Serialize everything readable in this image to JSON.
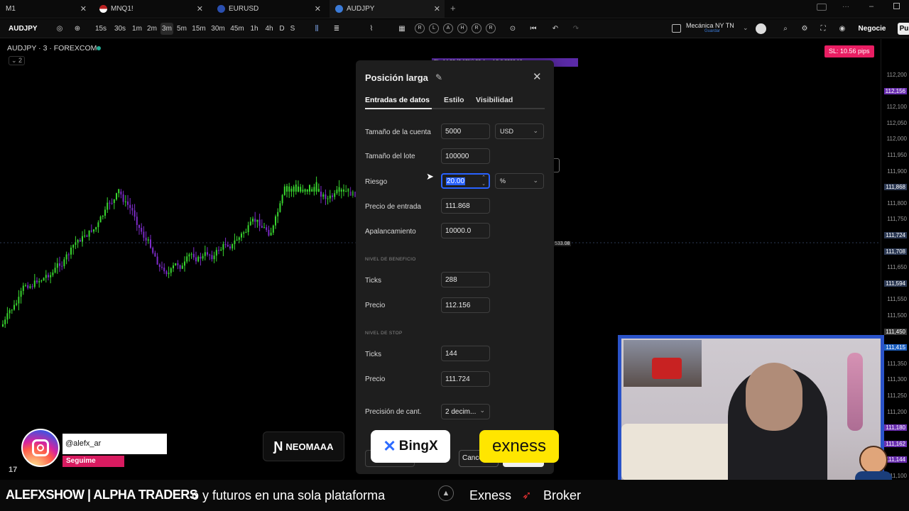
{
  "browser_tabs": [
    {
      "label": "M1",
      "icon": "chart-icon",
      "active": false
    },
    {
      "label": "MNQ1!",
      "icon": "us-flag-icon",
      "active": false
    },
    {
      "label": "EURUSD",
      "icon": "eu-flag-icon",
      "active": false
    },
    {
      "label": "AUDJPY",
      "icon": "tradingview-icon",
      "active": true
    }
  ],
  "toolbar": {
    "symbol": "AUDJPY",
    "intervals": [
      "15s",
      "30s",
      "1m",
      "2m",
      "3m",
      "5m",
      "15m",
      "30m",
      "45m",
      "1h",
      "4h",
      "D",
      "S"
    ],
    "active_interval": "3m",
    "replay": [
      "R",
      "L",
      "A",
      "H",
      "R",
      "R"
    ],
    "layout_name": "Mecánica NY TN",
    "layout_sub": "Guardar",
    "trade_button": "Negocie",
    "publish_button": "Pu"
  },
  "chart": {
    "title": "AUDJPY · 3 · FOREXCOM",
    "indicator_count": "2",
    "sl_badge": "SL: 10.56 pips",
    "target_label": "PL: 14.22 (0.12%) 20.4 ... 4 5 6 8266.16",
    "stop_label": "533.08",
    "price_labels": [
      {
        "text": "112,200",
        "hl": false
      },
      {
        "text": "112,156",
        "hl": true,
        "color": "#6a2fb0"
      },
      {
        "text": "112,100",
        "hl": false
      },
      {
        "text": "112,050",
        "hl": false
      },
      {
        "text": "112,000",
        "hl": false
      },
      {
        "text": "111,950",
        "hl": false
      },
      {
        "text": "111,900",
        "hl": false
      },
      {
        "text": "111,868",
        "hl": true,
        "color": "#2d3a55"
      },
      {
        "text": "111,800",
        "hl": false
      },
      {
        "text": "111,750",
        "hl": false
      },
      {
        "text": "111,724",
        "hl": true,
        "color": "#2d3a55"
      },
      {
        "text": "111,708",
        "hl": true,
        "color": "#2d3a55"
      },
      {
        "text": "111,650",
        "hl": false
      },
      {
        "text": "111,594",
        "hl": true,
        "color": "#2d3a55"
      },
      {
        "text": "111,550",
        "hl": false
      },
      {
        "text": "111,500",
        "hl": false
      },
      {
        "text": "111,450",
        "hl": true,
        "color": "#3a3a3a"
      },
      {
        "text": "111,415",
        "hl": true,
        "color": "#1c5fbf"
      },
      {
        "text": "111,350",
        "hl": false
      },
      {
        "text": "111,300",
        "hl": false
      },
      {
        "text": "111,250",
        "hl": false
      },
      {
        "text": "111,200",
        "hl": false
      },
      {
        "text": "111,180",
        "hl": true,
        "color": "#6a2fb0"
      },
      {
        "text": "111,162",
        "hl": true,
        "color": "#6a2fb0"
      },
      {
        "text": "111,144",
        "hl": true,
        "color": "#6a2fb0"
      },
      {
        "text": "111,100",
        "hl": false
      }
    ]
  },
  "dialog": {
    "title": "Posición larga",
    "tabs": [
      "Entradas de datos",
      "Estilo",
      "Visibilidad"
    ],
    "active_tab": "Entradas de datos",
    "account_size": {
      "label": "Tamaño de la cuenta",
      "value": "5000",
      "currency": "USD"
    },
    "lot_size": {
      "label": "Tamaño del lote",
      "value": "100000"
    },
    "risk": {
      "label": "Riesgo",
      "value": "20.00",
      "unit": "%"
    },
    "entry_price": {
      "label": "Precio de entrada",
      "value": "111.868"
    },
    "leverage": {
      "label": "Apalancamiento",
      "value": "10000.0"
    },
    "profit_section": "NIVEL DE BENEFICIO",
    "profit_ticks": {
      "label": "Ticks",
      "value": "288"
    },
    "profit_price": {
      "label": "Precio",
      "value": "112.156"
    },
    "stop_section": "NIVEL DE STOP",
    "stop_ticks": {
      "label": "Ticks",
      "value": "144"
    },
    "stop_price": {
      "label": "Precio",
      "value": "111.724"
    },
    "qty_precision": {
      "label": "Precisión de cant.",
      "value": "2 decim..."
    },
    "cancel_button": "Cance"
  },
  "overlays": {
    "instagram_handle": "@alefx_ar",
    "instagram_cta": "Seguime",
    "sponsor_neomaaa": "NEOMAAA",
    "sponsor_bingx": "BingX",
    "sponsor_exness": "exness",
    "ticker_brand": "ALEFXSHOW | ALPHA TRADERS",
    "ticker_text_1": "o y futuros en una sola plataforma",
    "ticker_text_2": "Exness",
    "ticker_text_3": "Broker",
    "tv_logo": "17"
  }
}
